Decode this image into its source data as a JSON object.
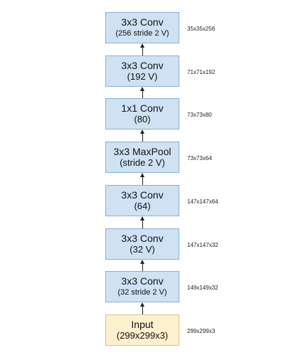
{
  "layers": [
    {
      "name": "3x3 Conv",
      "param": "(256 stride 2 V)",
      "dims": "35x35x256"
    },
    {
      "name": "3x3 Conv",
      "param": "(192 V)",
      "dims": "71x71x192"
    },
    {
      "name": "1x1 Conv",
      "param": "(80)",
      "dims": "73x73x80"
    },
    {
      "name": "3x3 MaxPool",
      "param": "(stride 2 V)",
      "dims": "73x73x64"
    },
    {
      "name": "3x3 Conv",
      "param": "(64)",
      "dims": "147x147x64"
    },
    {
      "name": "3x3 Conv",
      "param": "(32 V)",
      "dims": "147x147x32"
    },
    {
      "name": "3x3 Conv",
      "param": "(32 stride 2 V)",
      "dims": "149x149x32"
    },
    {
      "name": "Input",
      "param": "(299x299x3)",
      "dims": "299x299x3"
    }
  ],
  "colors": {
    "layer_fill": "#cfe2f3",
    "layer_border": "#8aaed0",
    "input_fill": "#fdf0cc",
    "input_border": "#d9c48a",
    "arrow": "#222222"
  }
}
